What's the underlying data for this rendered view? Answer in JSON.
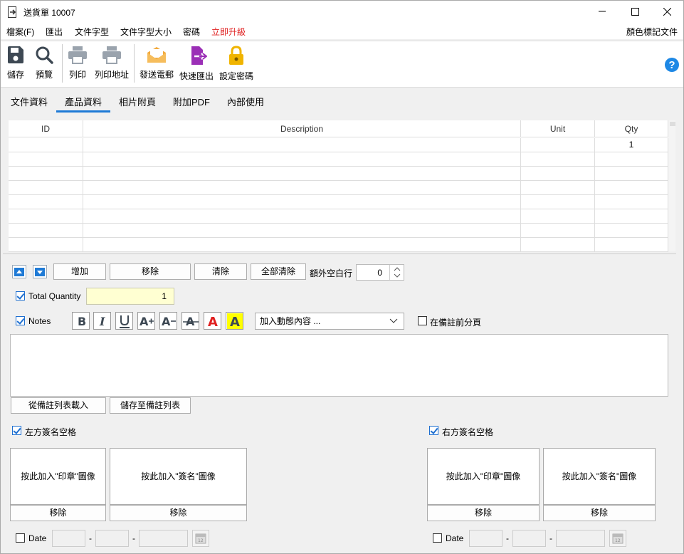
{
  "window": {
    "title": "送貨單 10007"
  },
  "menu": {
    "items": [
      "檔案(F)",
      "匯出",
      "文件字型",
      "文件字型大小",
      "密碼",
      "立即升級"
    ],
    "right_item": "顏色標記文件",
    "upgrade_color": "#e02020"
  },
  "toolbar": {
    "save": "儲存",
    "preview": "預覽",
    "print": "列印",
    "print_address": "列印地址",
    "send_email": "發送電郵",
    "quick_export": "快速匯出",
    "set_password": "設定密碼",
    "help_icon": "help-icon"
  },
  "tabs": [
    "文件資料",
    "產品資料",
    "相片附頁",
    "附加PDF",
    "內部使用"
  ],
  "active_tab": "產品資料",
  "table": {
    "columns": [
      "ID",
      "Description",
      "Unit",
      "Qty"
    ],
    "rows": [
      [
        "",
        "",
        "",
        "1"
      ],
      [
        "",
        "",
        "",
        ""
      ],
      [
        "",
        "",
        "",
        ""
      ],
      [
        "",
        "",
        "",
        ""
      ],
      [
        "",
        "",
        "",
        ""
      ],
      [
        "",
        "",
        "",
        ""
      ],
      [
        "",
        "",
        "",
        ""
      ],
      [
        "",
        "",
        "",
        ""
      ]
    ]
  },
  "row_actions": {
    "add": "增加",
    "remove": "移除",
    "clear": "清除",
    "clear_all": "全部清除",
    "extra_blank_rows_label": "額外空白行",
    "extra_blank_rows_value": "0"
  },
  "total_quantity": {
    "label": "Total Quantity",
    "value": "1",
    "checked": true
  },
  "notes": {
    "label": "Notes",
    "checked": true,
    "dynamic_content_placeholder": "加入動態內容 ...",
    "page_break_label": "在備註前分頁",
    "load_from_list": "從備註列表載入",
    "save_to_list": "儲存至備註列表"
  },
  "signature": {
    "left_label": "左方簽名空格",
    "right_label": "右方簽名空格",
    "add_stamp": "按此加入\"印章\"圖像",
    "add_signature": "按此加入\"簽名\"圖像",
    "remove": "移除",
    "date_label": "Date",
    "date_separator": "-"
  },
  "colors": {
    "accent": "#1e7ad6",
    "qty_bg": "#ffffd2",
    "email_icon": "#f2a93b",
    "export_icon": "#9b2fb6",
    "lock_icon": "#f0b400",
    "help_icon": "#1e88e5"
  }
}
